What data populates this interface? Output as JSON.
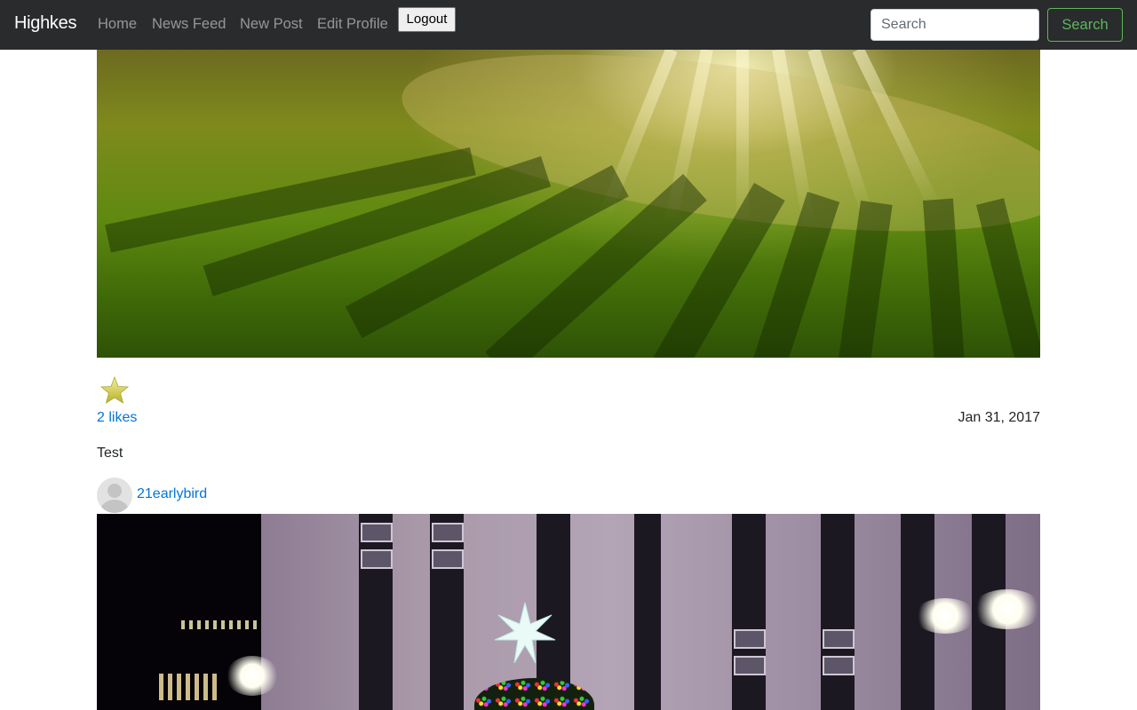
{
  "navbar": {
    "brand": "Highkes",
    "links": [
      {
        "label": "Home"
      },
      {
        "label": "News Feed"
      },
      {
        "label": "New Post"
      },
      {
        "label": "Edit Profile"
      }
    ],
    "logout_label": "Logout",
    "search": {
      "placeholder": "Search",
      "value": "",
      "button_label": "Search"
    },
    "colors": {
      "background": "#292b2c",
      "search_button": "#5cb85c"
    }
  },
  "posts": [
    {
      "image": "sunlight-through-trees-on-grass",
      "like_icon": "star-icon",
      "likes_label": "2 likes",
      "date": "Jan 31, 2017",
      "caption": "Test"
    },
    {
      "avatar": "default-user-avatar",
      "username": "21earlybird",
      "image": "night-building-with-christmas-tree"
    }
  ],
  "colors": {
    "link": "#0275d8",
    "text": "#212529"
  }
}
